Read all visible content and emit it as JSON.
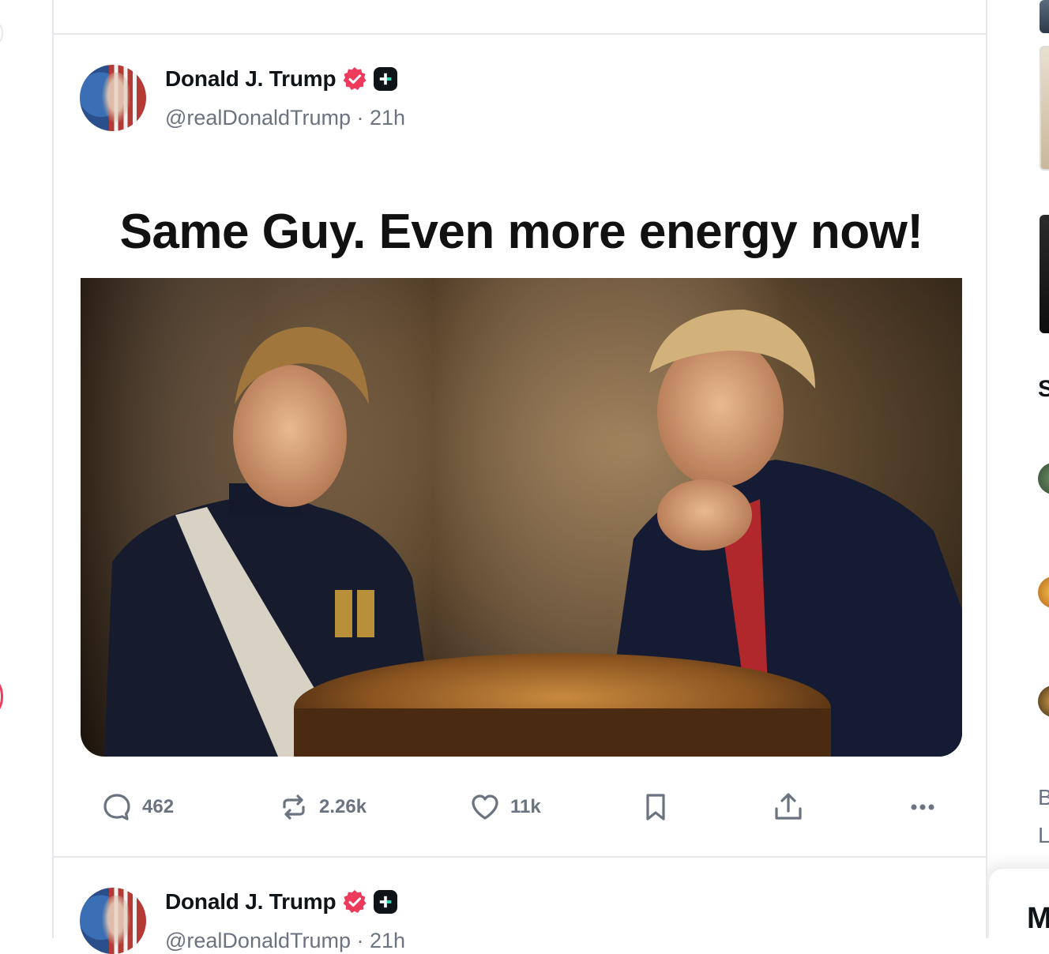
{
  "post": {
    "display_name": "Donald J. Trump",
    "handle": "@realDonaldTrump",
    "time": "21h",
    "image_text": "Same Guy. Even more energy now!",
    "stats": {
      "replies": "462",
      "reposts": "2.26k",
      "likes": "11k"
    }
  },
  "next_post": {
    "display_name": "Donald J. Trump",
    "handle": "@realDonaldTrump",
    "time": "21h"
  },
  "sidebar_fragments": {
    "heading_char": "S",
    "item_char_1": "B",
    "item_char_2": "L",
    "panel_char": "M"
  },
  "colors": {
    "verified_badge": "#ef3b5b",
    "muted_text": "#6b7280",
    "divider": "#e6e8ec"
  },
  "icons": [
    "verified-badge-icon",
    "plus-badge-icon",
    "reply-icon",
    "repost-icon",
    "like-icon",
    "bookmark-icon",
    "share-icon",
    "more-icon"
  ]
}
